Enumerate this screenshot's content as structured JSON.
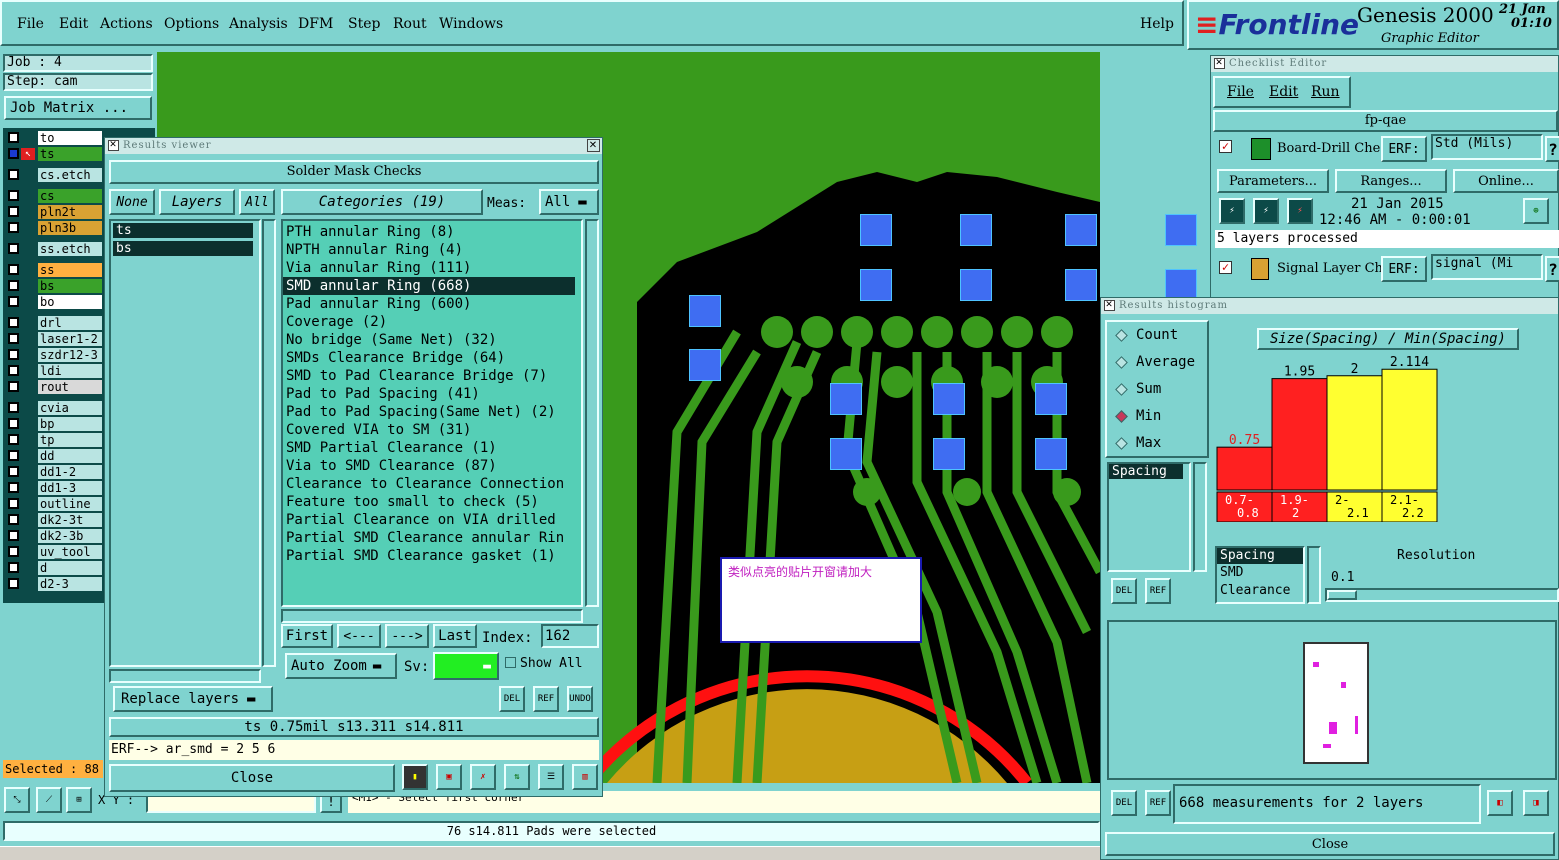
{
  "menubar": {
    "items": [
      "File",
      "Edit",
      "Actions",
      "Options",
      "Analysis",
      "DFM",
      "Step",
      "Rout",
      "Windows"
    ],
    "help": "Help"
  },
  "brand": {
    "logo": "Frontline",
    "product": "Genesis 2000",
    "subtitle": "Graphic Editor",
    "date": "21 Jan",
    "time": "01:10"
  },
  "job": {
    "job_label": "Job : 4",
    "step_label": "Step: cam",
    "matrix_button": "Job Matrix ..."
  },
  "layers": [
    {
      "name": "to",
      "color": "#ffffff"
    },
    {
      "name": "ts",
      "color": "#3aa22a",
      "active": true
    },
    {
      "name": "cs.etch",
      "color": "#b9e4e2"
    },
    {
      "name": "cs",
      "color": "#3aa22a"
    },
    {
      "name": "pln2t",
      "color": "#d9a233"
    },
    {
      "name": "pln3b",
      "color": "#d9a233"
    },
    {
      "name": "ss.etch",
      "color": "#b9e4e2"
    },
    {
      "name": "ss",
      "color": "#ffb040"
    },
    {
      "name": "bs",
      "color": "#3aa22a"
    },
    {
      "name": "bo",
      "color": "#ffffff"
    },
    {
      "name": "drl",
      "color": "#b9e4e2"
    },
    {
      "name": "laser1-2",
      "color": "#b9e4e2"
    },
    {
      "name": "szdr12-3",
      "color": "#b9e4e2"
    },
    {
      "name": "ldi",
      "color": "#b9e4e2"
    },
    {
      "name": "rout",
      "color": "#d9d9d9"
    },
    {
      "name": "cvia",
      "color": "#b9e4e2"
    },
    {
      "name": "bp",
      "color": "#b9e4e2"
    },
    {
      "name": "tp",
      "color": "#b9e4e2"
    },
    {
      "name": "dd",
      "color": "#b9e4e2"
    },
    {
      "name": "dd1-2",
      "color": "#b9e4e2"
    },
    {
      "name": "dd1-3",
      "color": "#b9e4e2"
    },
    {
      "name": "outline",
      "color": "#b9e4e2"
    },
    {
      "name": "dk2-3t",
      "color": "#b9e4e2"
    },
    {
      "name": "dk2-3b",
      "color": "#b9e4e2"
    },
    {
      "name": "uv_tool",
      "color": "#b9e4e2"
    },
    {
      "name": "d",
      "color": "#b9e4e2"
    },
    {
      "name": "d2-3",
      "color": "#b9e4e2"
    }
  ],
  "selected_label": "Selected : 88",
  "results_viewer": {
    "title": "Results viewer",
    "heading": "Solder Mask Checks",
    "none_btn": "None",
    "layers_btn": "Layers",
    "all_btn": "All",
    "layer_list": [
      "ts",
      "bs"
    ],
    "categories_btn": "Categories (19)",
    "meas_label": "Meas:",
    "meas_value": "All",
    "categories": [
      "PTH annular Ring (8)",
      "NPTH annular Ring (4)",
      "Via annular Ring (111)",
      "SMD annular Ring (668)",
      "Pad annular Ring (600)",
      "Coverage (2)",
      "No bridge (Same Net) (32)",
      "SMDs Clearance Bridge (64)",
      "SMD to Pad Clearance Bridge (7)",
      "Pad to Pad Spacing (41)",
      "Pad to Pad Spacing(Same Net) (2)",
      "Covered VIA to SM (31)",
      "SMD Partial Clearance (1)",
      "Via to SMD Clearance (87)",
      "Clearance to Clearance Connection",
      "Feature too small to check (5)",
      "Partial Clearance on VIA drilled",
      "Partial SMD Clearance annular Rin",
      "Partial SMD Clearance gasket (1)"
    ],
    "selected_index": 3,
    "first": "First",
    "prev": "<---",
    "next": "--->",
    "last": "Last",
    "index_label": "Index:",
    "index_value": "162",
    "auto_zoom": "Auto Zoom",
    "sv_label": "Sv:",
    "show_all": "Show All",
    "replace_layers": "Replace layers",
    "del": "DEL",
    "ref": "REF",
    "undo": "UNDO",
    "status": "ts 0.75mil  s13.311  s14.811",
    "erf": "ERF--> ar_smd = 2 5 6",
    "close": "Close"
  },
  "annotation": "类似点亮的贴片开窗请加大",
  "bottom": {
    "xy_label": "X Y :",
    "prompt": "<M1> - Select first corner",
    "status": "76 s14.811 Pads were selected"
  },
  "checklist": {
    "title": "Checklist Editor",
    "menu": [
      "File",
      "Edit",
      "Run"
    ],
    "name": "fp-qae",
    "row1_label": "Board-Drill Che",
    "erf": "ERF:",
    "row1_erf": "Std (Mils)",
    "parameters": "Parameters...",
    "ranges": "Ranges...",
    "online": "Online...",
    "date": "21 Jan 2015",
    "time": "12:46 AM - 0:00:01",
    "processed": "5 layers processed",
    "row2_label": "Signal Layer Ch",
    "row2_erf": "signal (Mi"
  },
  "histogram": {
    "title": "Results histogram",
    "options": [
      "Count",
      "Average",
      "Sum",
      "Min",
      "Max"
    ],
    "selected_option": "Min",
    "chart_title": "Size(Spacing) / Min(Spacing)",
    "list": [
      "Spacing"
    ],
    "sel_list": [
      "Spacing",
      "SMD",
      "Clearance"
    ],
    "resolution_label": "Resolution",
    "resolution_value": "0.1",
    "del": "DEL",
    "ref": "REF",
    "measurements": "668 measurements for 2 layers",
    "close": "Close"
  },
  "chart_data": {
    "type": "bar",
    "categories": [
      "0.7-0.8",
      "1.9-2",
      "2-2.1",
      "2.1-2.2"
    ],
    "category_lines": [
      [
        "0.7-",
        "0.8"
      ],
      [
        "1.9-",
        "2"
      ],
      [
        "2-",
        "2.1"
      ],
      [
        "2.1-",
        "2.2"
      ]
    ],
    "values": [
      0.75,
      1.95,
      2,
      2.114
    ],
    "value_labels": [
      "0.75",
      "1.95",
      "2",
      "2.114"
    ],
    "colors": [
      "#ff2020",
      "#ff2020",
      "#ffff30",
      "#ffff30"
    ],
    "title": "Size(Spacing) / Min(Spacing)"
  }
}
